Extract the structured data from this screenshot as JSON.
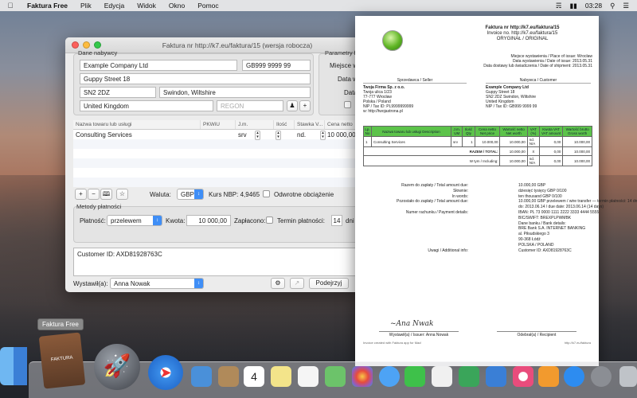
{
  "menubar": {
    "app_name": "Faktura Free",
    "items": [
      "Plik",
      "Edycja",
      "Widok",
      "Okno",
      "Pomoc"
    ],
    "clock": "03:28"
  },
  "window": {
    "title": "Faktura nr http://k7.eu/faktura/15 (wersja robocza)",
    "buyer": {
      "group_label": "Dane nabywcy",
      "company": "Example Company Ltd",
      "nip": "GB999 9999 99",
      "street": "Guppy Street 18",
      "postcode": "SN2 2DZ",
      "city": "Swindon, Wiltshire",
      "country": "United Kingdom",
      "regon_placeholder": "REGON"
    },
    "params": {
      "group_label": "Parametry fa",
      "place_label": "Miejsce w",
      "date1_label": "Data w",
      "date2_label": "Data"
    },
    "table": {
      "columns": [
        "Nazwa towaru lub usługi",
        "PKWiU",
        "J.m.",
        "Ilość",
        "Stawka V...",
        "Cena netto"
      ],
      "rows": [
        {
          "name": "Consulting Services",
          "pkwiu": "",
          "unit": "srv",
          "qty": "1",
          "vat": "nd.",
          "price": "10 000,00"
        }
      ]
    },
    "currency_label": "Waluta:",
    "currency_value": "GBP",
    "nbp_label": "Kurs NBP: 4,9465",
    "reverse_charge_label": "Odwrotne obciążenie",
    "payment": {
      "group_label": "Metody płatności",
      "method_label": "Płatność:",
      "method_value": "przelewem",
      "amount_label": "Kwota:",
      "amount_value": "10 000,00",
      "paid_label": "Zapłacono:",
      "term_label": "Termin płatności:",
      "term_value": "14",
      "term_unit": "dni"
    },
    "notes": "Customer ID: AXD81928763C",
    "issuer_label": "Wystawił(a):",
    "issuer_value": "Anna Nowak",
    "preview_button": "Podejrzyj"
  },
  "invoice": {
    "line1": "Faktura nr http://k7.eu/faktura/15",
    "line2": "Invoice no. http://k7.eu/faktura/15",
    "line3": "ORYGINAŁ / ORIGINAL",
    "place": "Miejsce wystawienia / Place of issue: Wrocław",
    "date_issue": "Data wystawienia / Date of issue: 2013.05.31",
    "date_delivery": "Data dostawy lub świadczenia / Date of shipment: 2013.05.31",
    "seller_title": "Sprzedawca / Seller",
    "seller": [
      "Twoja Firma Sp. z o.o.",
      "Twoja ulica 1/23",
      "77-777 Wrocław",
      "Polska / Poland",
      "NIP / Tax ID: PL9999999999",
      "w: http://twojastrona.pl"
    ],
    "buyer_title": "Nabywca / Customer",
    "buyer": [
      "Example Company Ltd",
      "Guppy Street 18",
      "SN2 2DZ Swindon, Wiltshire",
      "United Kingdom",
      "NIP / Tax ID: GB999 9999 99"
    ],
    "table_head": [
      "Lp. No",
      "Nazwa towaru lub usługi Description",
      "J.m. UM",
      "Ilość Qty",
      "Cena netto Net price",
      "Wartość netto Net worth",
      "VAT (%)",
      "Kwota VAT VAT amount",
      "Wartość brutto Gross worth"
    ],
    "table_row": [
      "1",
      "Consulting Services",
      "srv",
      "1",
      "10.000,00",
      "10.000,00",
      "nd. N/A",
      "0,00",
      "10.000,00"
    ],
    "total_label": "RAZEM / TOTAL:",
    "total_row": [
      "10.000,00",
      "X",
      "0,00",
      "10.000,00"
    ],
    "incl_label": "W tym / Including:",
    "incl_row": [
      "10.000,00",
      "nd. N/A",
      "0,00",
      "10.000,00"
    ],
    "summary": [
      {
        "k": "Razem do zapłaty / Total amount due:",
        "v": "10.000,00 GBP"
      },
      {
        "k": "Słownie:",
        "v": "dziesięć tysięcy GBP 0/100"
      },
      {
        "k": "In words:",
        "v": "ten thousand GBP 0/100"
      },
      {
        "k": "Pozostało do zapłaty / Total amount due:",
        "v": "10.000,00 GBP przelewem / wire transfer — termin płatności: 14 dni"
      },
      {
        "k": "",
        "v": "do: 2013.06.14 / due date: 2013.06.14 (14 days)"
      },
      {
        "k": "Numer rachunku / Payment details:",
        "v": "IBAN: PL 73 0000 1111 2222 3333 4444 5555"
      },
      {
        "k": "",
        "v": "BIC/SWIFT: BREXPLPWMBK"
      },
      {
        "k": "",
        "v": "Dane banku / Bank details:"
      },
      {
        "k": "",
        "v": "BRE Bank S.A. INTERNET BANKING"
      },
      {
        "k": "",
        "v": "al. Piłsudskiego 3"
      },
      {
        "k": "",
        "v": "90-368 Łódź"
      },
      {
        "k": "",
        "v": "POLSKA / POLAND"
      },
      {
        "k": "Uwagi / Additional info:",
        "v": "Customer ID: AXD81928763C"
      }
    ],
    "sign_issuer": "Wystawił(a) / Issuer: Anna Nowak",
    "sign_recipient": "Odebrał(a) / Recipient",
    "footer_left": "Invoice created with Faktura app for Mac!",
    "footer_right": "http://k7.eu/faktura"
  },
  "dock": {
    "tooltip": "Faktura Free",
    "app_label": "FAKTURA"
  },
  "colors": {
    "invoice_header_green": "#5cc34a",
    "popup_blue": "#3f8ef6"
  }
}
